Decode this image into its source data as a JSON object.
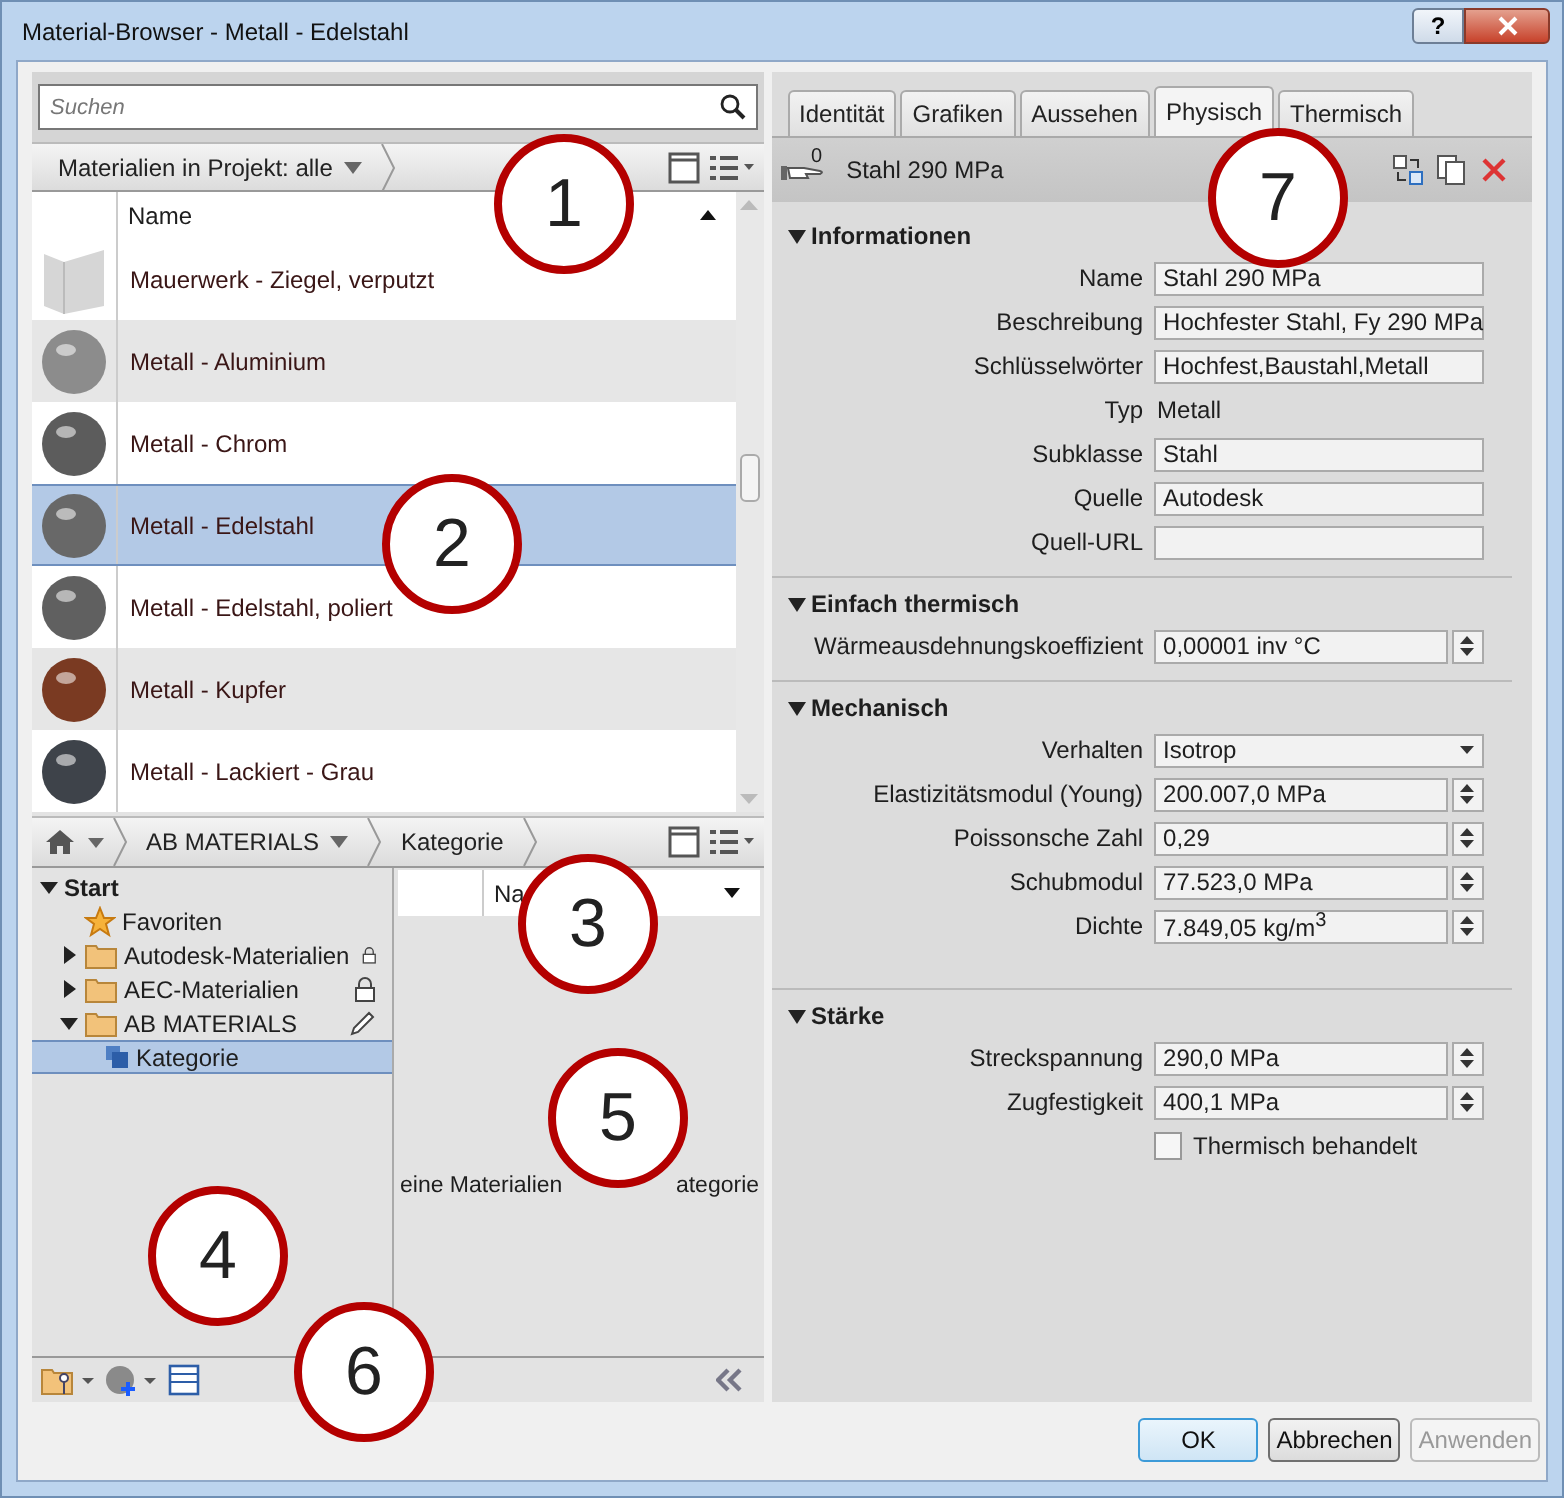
{
  "window": {
    "title": "Material-Browser - Metall - Edelstahl",
    "help_button": "?"
  },
  "search": {
    "placeholder": "Suchen"
  },
  "project_bar": {
    "filter": "Materialien in Projekt: alle"
  },
  "material_list": {
    "column": "Name",
    "rows": [
      {
        "name": "Mauerwerk - Ziegel, verputzt",
        "kind": "wall",
        "color": "#d6d6d6",
        "selected": false
      },
      {
        "name": "Metall - Aluminium",
        "kind": "sphere",
        "color": "#8c8c8c",
        "selected": false
      },
      {
        "name": "Metall - Chrom",
        "kind": "sphere",
        "color": "#5c5c5c",
        "selected": false
      },
      {
        "name": "Metall - Edelstahl",
        "kind": "sphere",
        "color": "#686868",
        "selected": true
      },
      {
        "name": "Metall - Edelstahl, poliert",
        "kind": "sphere",
        "color": "#606060",
        "selected": false
      },
      {
        "name": "Metall - Kupfer",
        "kind": "sphere",
        "color": "#7a3a22",
        "selected": false
      },
      {
        "name": "Metall - Lackiert - Grau",
        "kind": "sphere",
        "color": "#3e434a",
        "selected": false
      }
    ]
  },
  "library_bar": {
    "crumbs": [
      "AB MATERIALS",
      "Kategorie"
    ]
  },
  "tree": [
    {
      "label": "Start",
      "kind": "root",
      "expanded": true,
      "selected": false,
      "children": [
        {
          "label": "Favoriten",
          "kind": "favorites",
          "selected": false
        },
        {
          "label": "Autodesk-Materialien",
          "kind": "library",
          "expanded": false,
          "locked": true,
          "selected": false
        },
        {
          "label": "AEC-Materialien",
          "kind": "library",
          "expanded": false,
          "locked": true,
          "selected": false
        },
        {
          "label": "AB MATERIALS",
          "kind": "library",
          "expanded": true,
          "locked": false,
          "selected": false,
          "children": [
            {
              "label": "Kategorie",
              "kind": "category",
              "selected": true
            }
          ]
        }
      ]
    }
  ],
  "library_list": {
    "column": "Na",
    "empty_message_parts": [
      "eine Materialien",
      "ategorie"
    ]
  },
  "tabs": [
    {
      "label": "Identität",
      "selected": false
    },
    {
      "label": "Grafiken",
      "selected": false
    },
    {
      "label": "Aussehen",
      "selected": false
    },
    {
      "label": "Physisch",
      "selected": true
    },
    {
      "label": "Thermisch",
      "selected": false
    }
  ],
  "asset": {
    "count": "0",
    "name": "Stahl 290 MPa"
  },
  "sections": [
    {
      "title": "Informationen",
      "expanded": true,
      "rows": [
        {
          "label": "Name",
          "kind": "text",
          "value": "Stahl 290 MPa"
        },
        {
          "label": "Beschreibung",
          "kind": "text",
          "value": "Hochfester Stahl, Fy 290 MPa"
        },
        {
          "label": "Schlüsselwörter",
          "kind": "text",
          "value": "Hochfest,Baustahl,Metall"
        },
        {
          "label": "Typ",
          "kind": "static",
          "value": "Metall"
        },
        {
          "label": "Subklasse",
          "kind": "text",
          "value": "Stahl"
        },
        {
          "label": "Quelle",
          "kind": "text",
          "value": "Autodesk"
        },
        {
          "label": "Quell-URL",
          "kind": "text"
        }
      ]
    },
    {
      "title": "Einfach thermisch",
      "expanded": true,
      "rows": [
        {
          "label": "Wärmeausdehnungskoeffizient",
          "kind": "spinner",
          "value": "0,00001 inv °C"
        }
      ]
    },
    {
      "title": "Mechanisch",
      "expanded": true,
      "rows": [
        {
          "label": "Verhalten",
          "kind": "dropdown",
          "value": "Isotrop"
        },
        {
          "label": "Elastizitätsmodul (Young)",
          "kind": "spinner",
          "value": "200.007,0 MPa"
        },
        {
          "label": "Poissonsche Zahl",
          "kind": "spinner",
          "value": "0,29"
        },
        {
          "label": "Schubmodul",
          "kind": "spinner",
          "value": "77.523,0 MPa"
        },
        {
          "label": "Dichte",
          "kind": "spinner",
          "value": "7.849,05 kg/m$^{3}$"
        }
      ]
    },
    {
      "title": "Stärke",
      "expanded": true,
      "rows": [
        {
          "label": "Streckspannung",
          "kind": "spinner",
          "value": "290,0 MPa"
        },
        {
          "label": "Zugfestigkeit",
          "kind": "spinner",
          "value": "400,1 MPa"
        },
        {
          "label": "Thermisch behandelt",
          "kind": "checkbox",
          "checked": false
        }
      ]
    }
  ],
  "buttons": [
    {
      "label": "OK",
      "default": true,
      "disabled": false
    },
    {
      "label": "Abbrechen",
      "default": false,
      "disabled": false
    },
    {
      "label": "Anwenden",
      "default": false,
      "disabled": true
    }
  ],
  "callouts": [
    "1",
    "2",
    "3",
    "4",
    "5",
    "6",
    "7"
  ]
}
